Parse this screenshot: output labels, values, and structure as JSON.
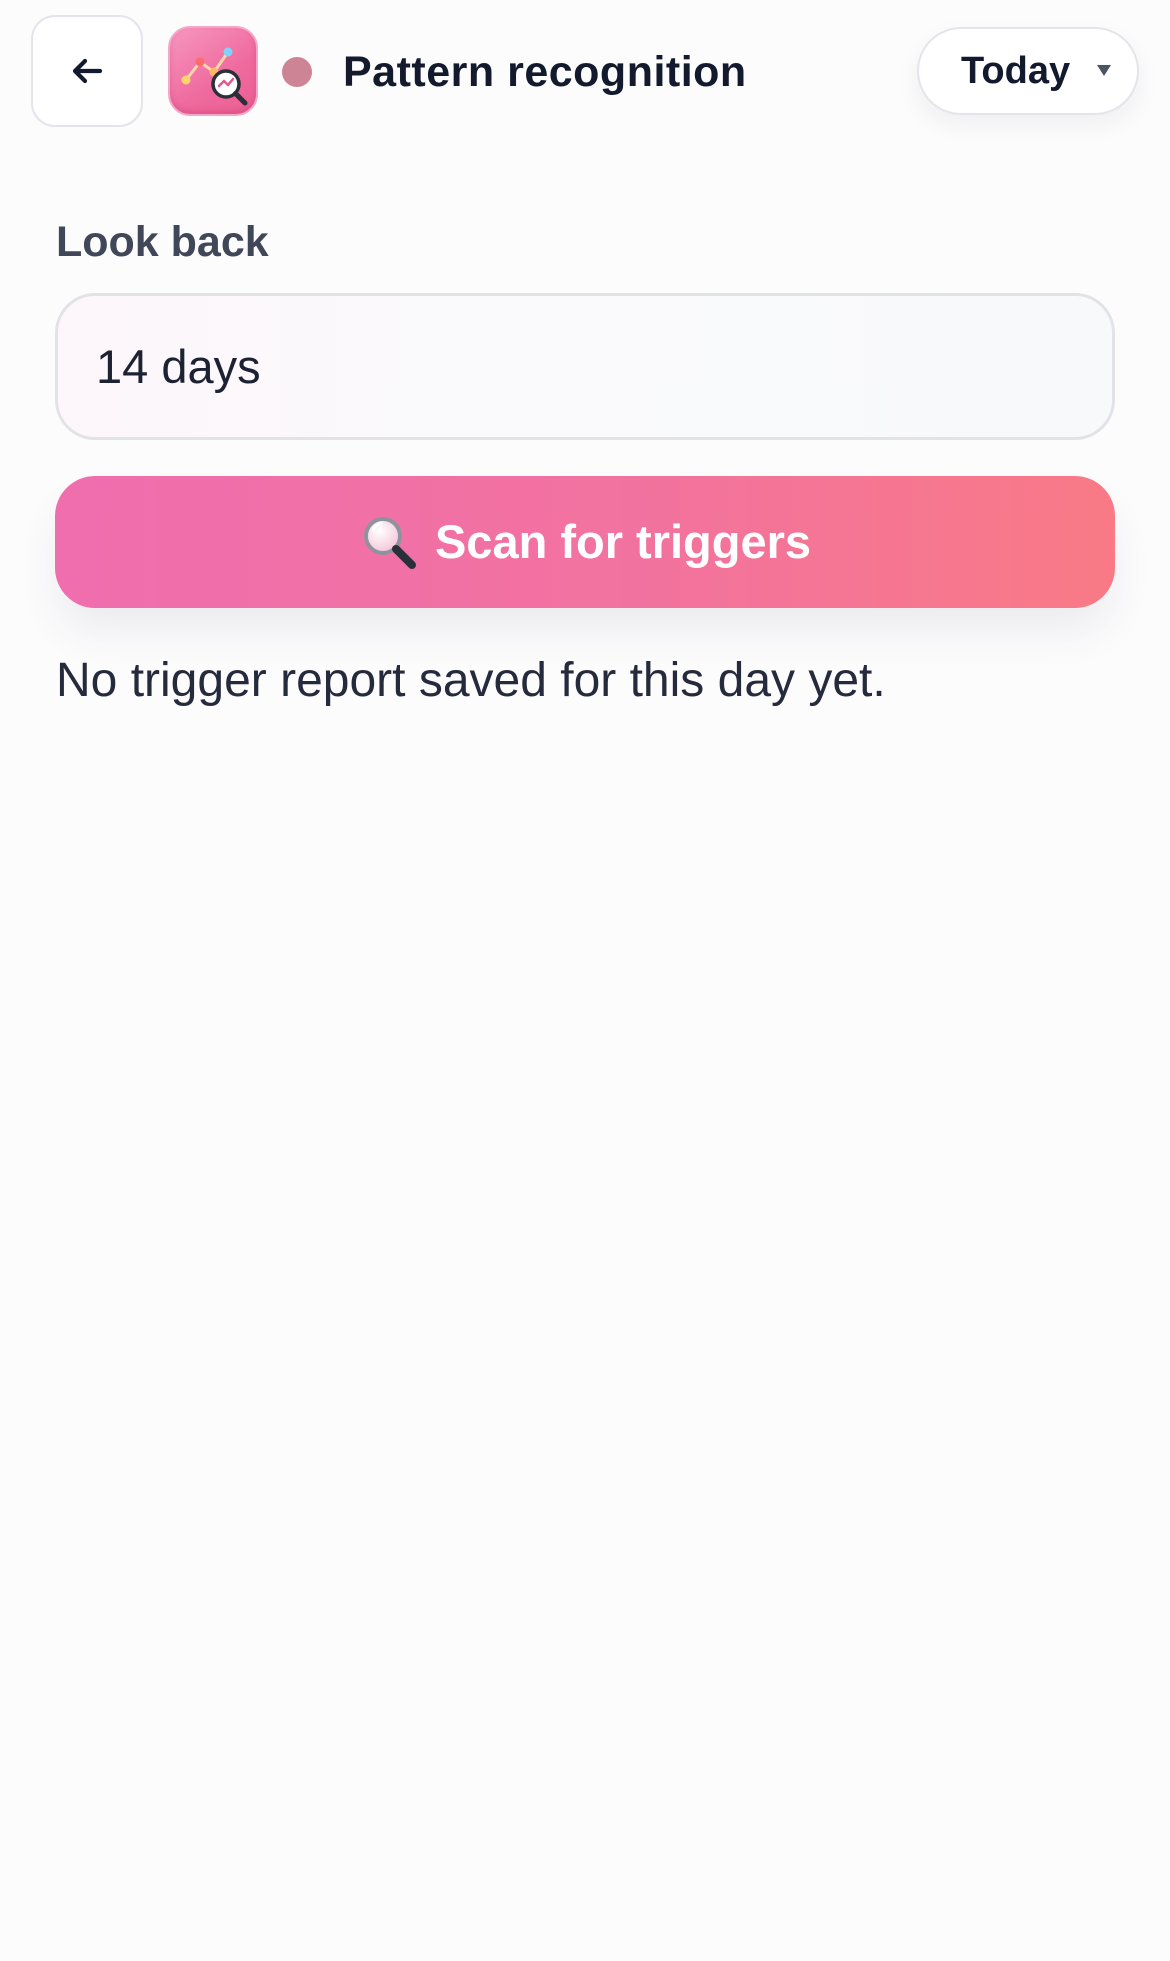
{
  "header": {
    "back_icon": "arrow-left-icon",
    "app_icon": "pattern-chart-magnifier-icon",
    "status_dot_color": "#cd8494",
    "title": "Pattern recognition",
    "date_select": {
      "selected": "Today",
      "icon": "chevron-down-icon"
    }
  },
  "form": {
    "lookback": {
      "label": "Look back",
      "value": "14 days"
    },
    "scan_button": {
      "icon": "magnifier-icon",
      "label": "Scan for triggers"
    }
  },
  "result": {
    "empty_message": "No trigger report saved for this day yet."
  },
  "colors": {
    "accent_start": "#f06eae",
    "accent_end": "#f97a86",
    "text_primary": "#141a2e",
    "label": "#3f4759"
  }
}
